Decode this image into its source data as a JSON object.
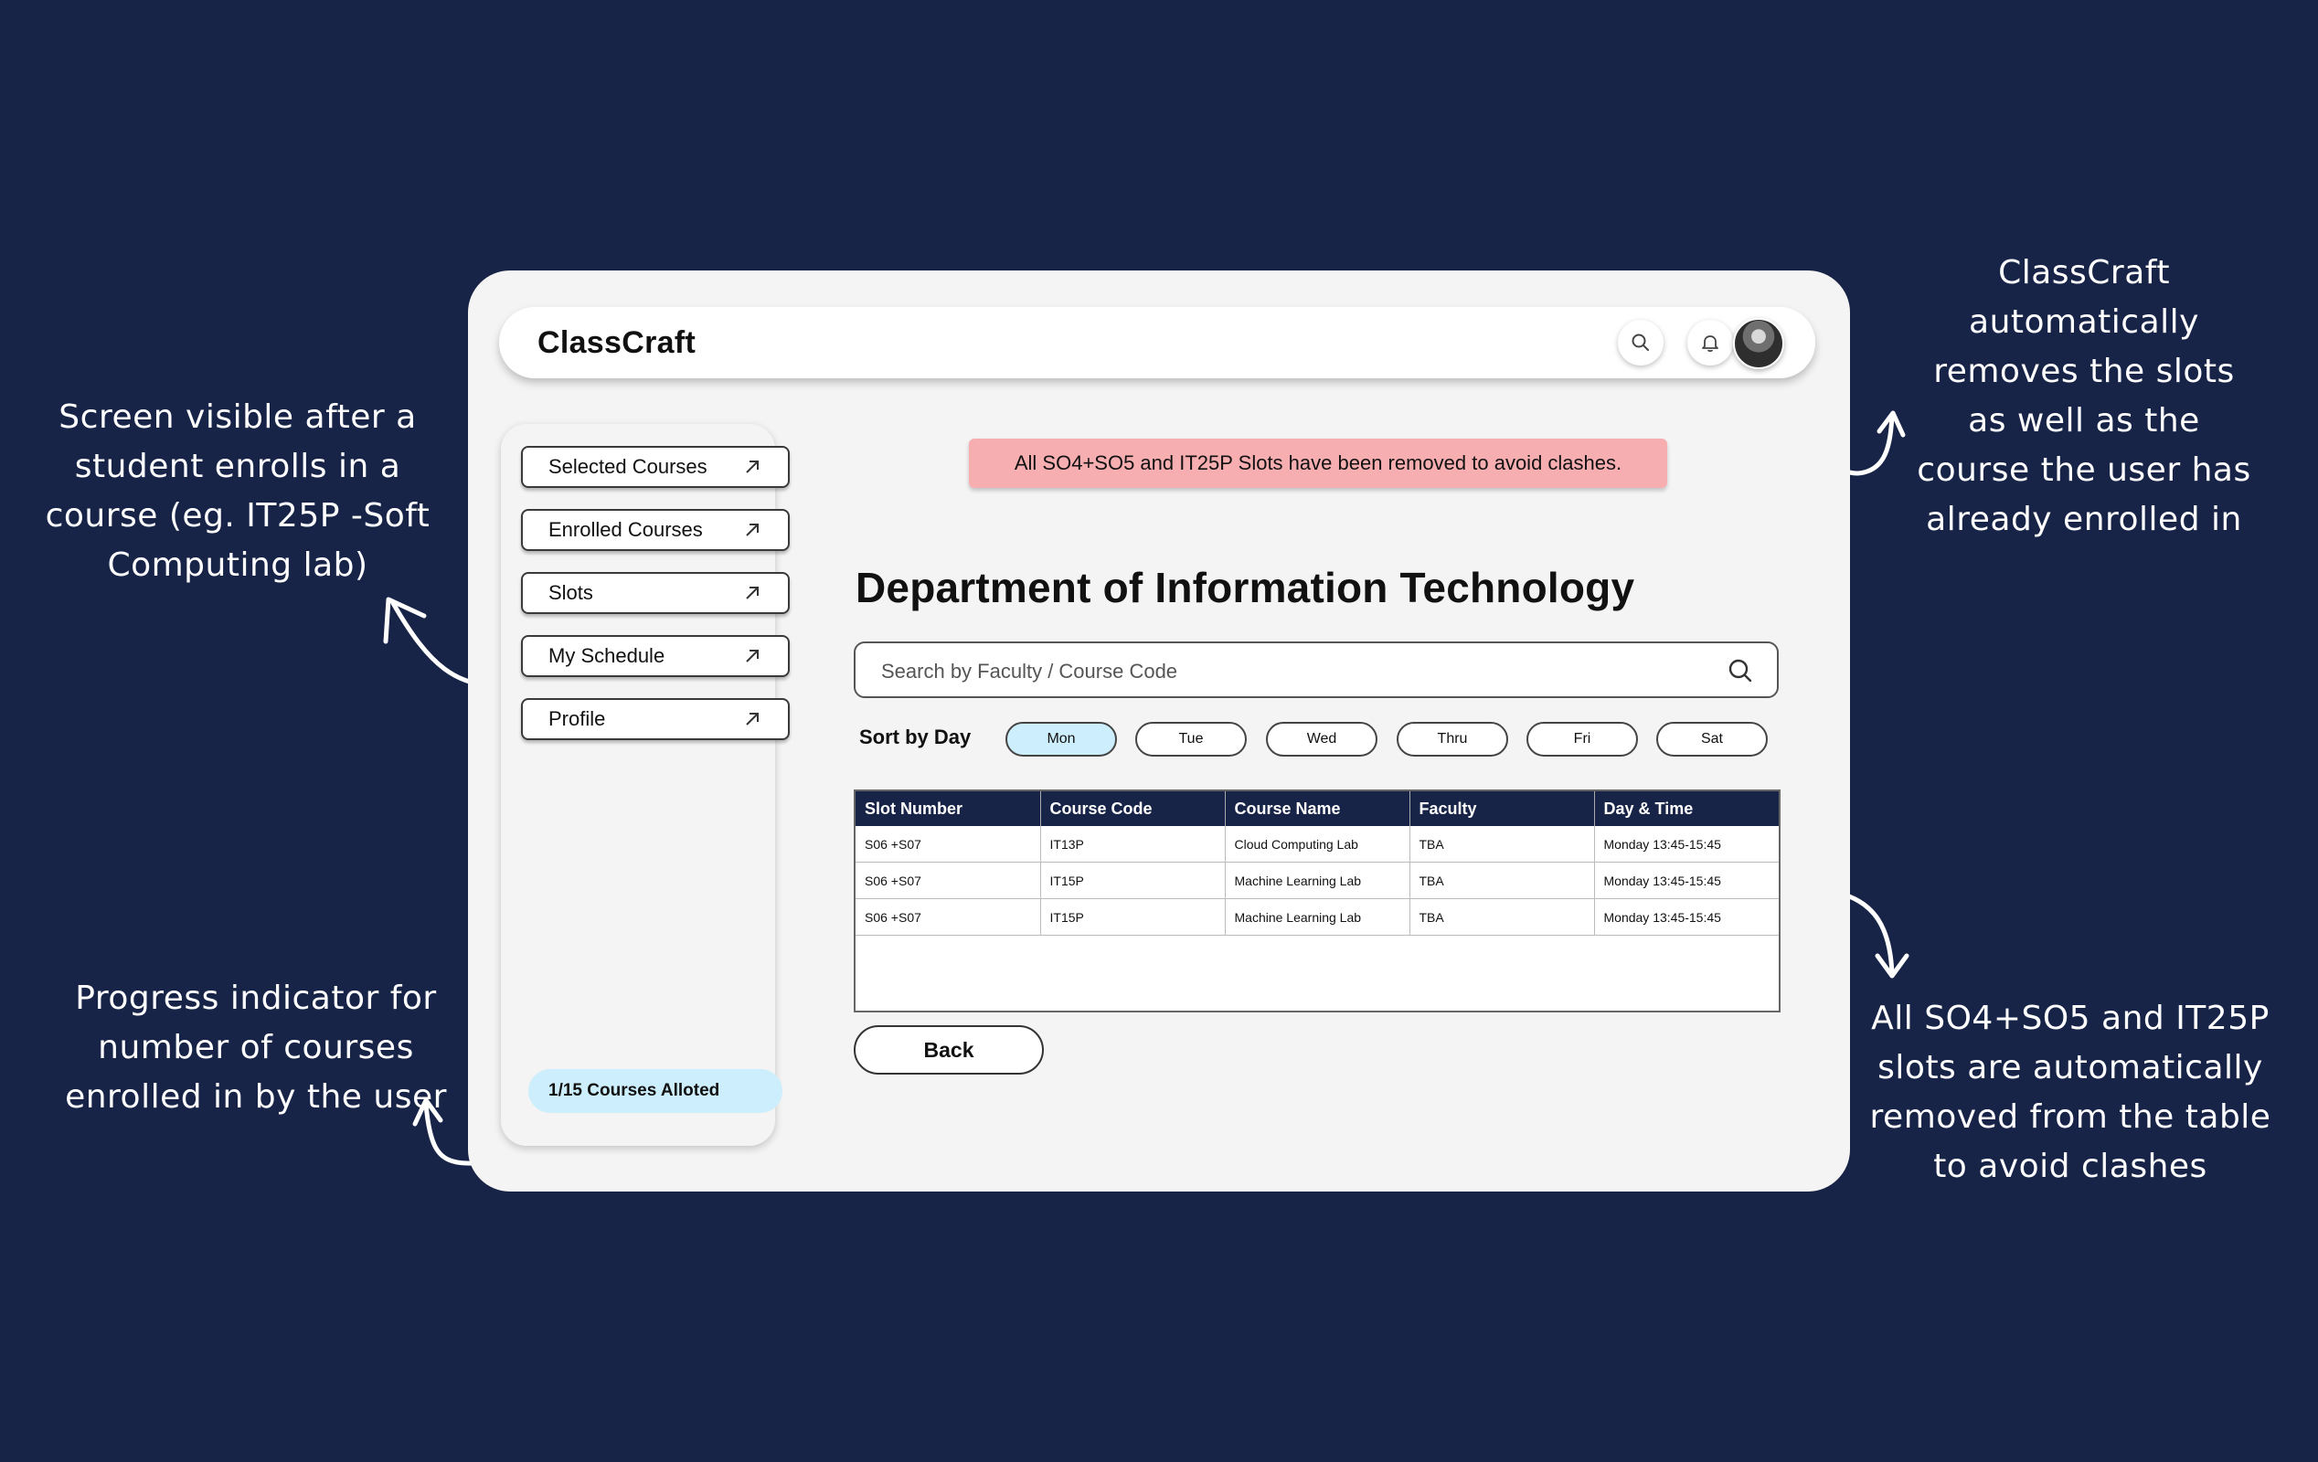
{
  "app": {
    "brand": "ClassCraft",
    "alert": "All SO4+SO5 and IT25P Slots have been removed to avoid clashes.",
    "page_title": "Department of Information Technology",
    "search": {
      "placeholder": "Search by Faculty / Course Code",
      "value": ""
    },
    "sort_label": "Sort by Day",
    "days": [
      "Mon",
      "Tue",
      "Wed",
      "Thru",
      "Fri",
      "Sat"
    ],
    "active_day": "Mon",
    "sidebar": {
      "items": [
        {
          "label": "Selected Courses"
        },
        {
          "label": "Enrolled Courses"
        },
        {
          "label": "Slots"
        },
        {
          "label": "My Schedule"
        },
        {
          "label": "Profile"
        }
      ],
      "progress_label": "1/15 Courses Alloted",
      "progress": {
        "enrolled": 1,
        "total": 15
      }
    },
    "table": {
      "headers": [
        "Slot Number",
        "Course Code",
        "Course Name",
        "Faculty",
        "Day & Time"
      ],
      "rows": [
        [
          "S06 +S07",
          "IT13P",
          "Cloud Computing Lab",
          "TBA",
          "Monday 13:45-15:45"
        ],
        [
          "S06 +S07",
          "IT15P",
          "Machine Learning Lab",
          "TBA",
          "Monday 13:45-15:45"
        ],
        [
          "S06 +S07",
          "IT15P",
          "Machine Learning Lab",
          "TBA",
          "Monday 13:45-15:45"
        ]
      ]
    },
    "back_label": "Back"
  },
  "annotations": {
    "left_top": "Screen visible after a student enrolls in a course (eg.  IT25P -Soft Computing lab)",
    "left_bottom": "Progress indicator for number of courses enrolled in by the user",
    "right_top": "ClassCraft automatically removes the slots as well as the course the user has already enrolled in",
    "right_bottom": "All SO4+SO5 and IT25P slots are automatically removed from the table to avoid clashes"
  },
  "colors": {
    "background": "#172447",
    "alert": "#f7aeb1",
    "active_pill": "#cdeefc",
    "table_header": "#172447"
  }
}
